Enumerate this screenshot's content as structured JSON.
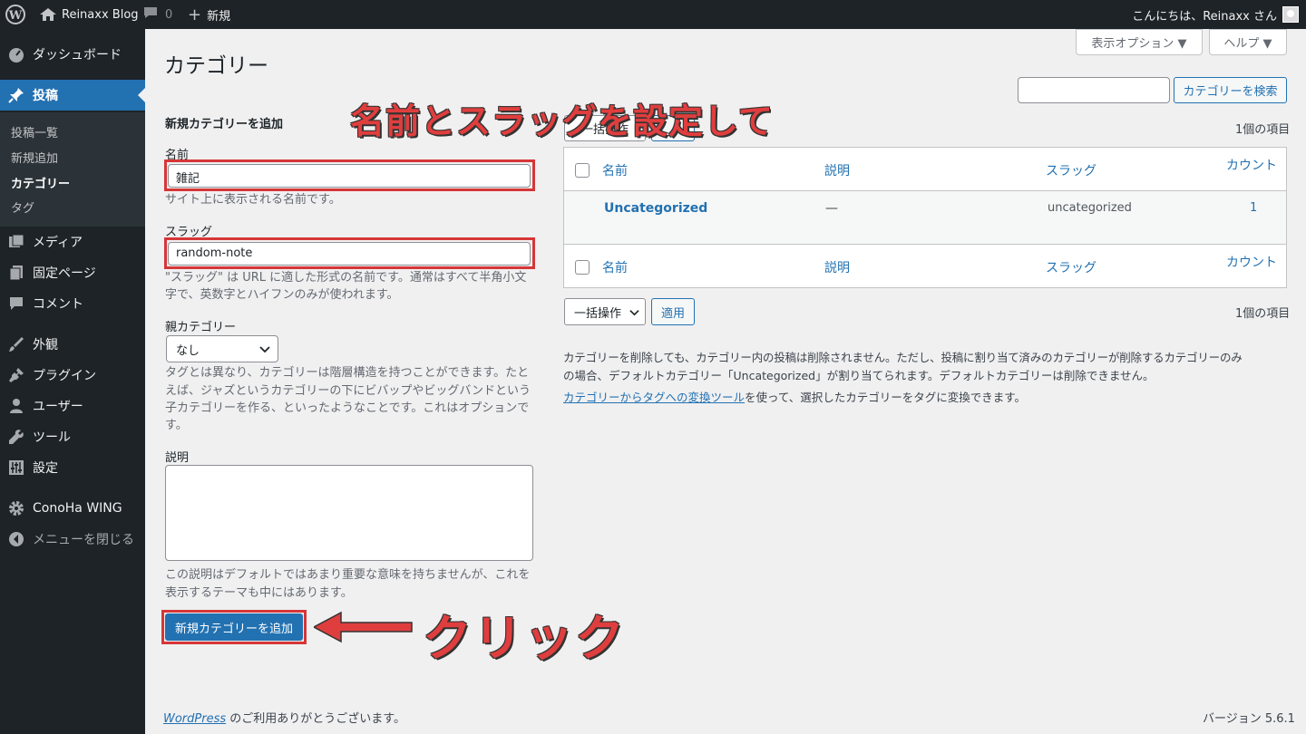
{
  "adminbar": {
    "site_name": "Reinaxx Blog",
    "comments_count": "0",
    "new_label": "新規",
    "greeting": "こんにちは、Reinaxx さん"
  },
  "sidebar": {
    "dashboard": "ダッシュボード",
    "posts": "投稿",
    "posts_sub": [
      "投稿一覧",
      "新規追加",
      "カテゴリー",
      "タグ"
    ],
    "media": "メディア",
    "pages": "固定ページ",
    "comments": "コメント",
    "appearance": "外観",
    "plugins": "プラグイン",
    "users": "ユーザー",
    "tools": "ツール",
    "settings": "設定",
    "conoha": "ConoHa WING",
    "collapse": "メニューを閉じる"
  },
  "header": {
    "screen_options": "表示オプション ▼",
    "help": "ヘルプ ▼",
    "page_title": "カテゴリー",
    "search_button": "カテゴリーを検索",
    "search_value": ""
  },
  "form": {
    "heading": "新規カテゴリーを追加",
    "name_label": "名前",
    "name_value": "雑記",
    "name_desc": "サイト上に表示される名前です。",
    "slug_label": "スラッグ",
    "slug_value": "random-note",
    "slug_desc_1": "\"スラッグ\" は URL に適した形式の名前です。通常はすべて半角小文",
    "slug_desc_2": "字で、英数字とハイフンのみが使われます。",
    "parent_label": "親カテゴリー",
    "parent_value": "なし",
    "parent_desc_1": "タグとは異なり、カテゴリーは階層構造を持つことができます。たと",
    "parent_desc_2": "えば、ジャズというカテゴリーの下にビバップやビッグバンドという",
    "parent_desc_3": "子カテゴリーを作る、といったようなことです。これはオプションで",
    "parent_desc_4": "す。",
    "description_label": "説明",
    "description_value": "",
    "description_desc_1": "この説明はデフォルトではあまり重要な意味を持ちませんが、これを",
    "description_desc_2": "表示するテーマも中にはあります。",
    "submit_label": "新規カテゴリーを追加"
  },
  "table": {
    "bulk_top": "一括操作",
    "items_count": "1個の項目",
    "columns": [
      "名前",
      "説明",
      "スラッグ",
      "カウント"
    ],
    "rows": [
      {
        "name": "Uncategorized",
        "description": "—",
        "slug": "uncategorized",
        "count": "1"
      }
    ],
    "bulk_bottom": "一括操作",
    "apply_bottom": "適用"
  },
  "notes": {
    "line1": "カテゴリーを削除しても、カテゴリー内の投稿は削除されません。ただし、投稿に割り当て済みのカテゴリーが削除するカテゴリーのみ",
    "line2": "の場合、デフォルトカテゴリー「Uncategorized」が割り当てられます。デフォルトカテゴリーは削除できません。",
    "link": "カテゴリーからタグへの変換ツール",
    "line3": "を使って、選択したカテゴリーをタグに変換できます。"
  },
  "footer": {
    "wp_link": "WordPress",
    "thanks": " のご利用ありがとうございます。",
    "version": "バージョン 5.6.1"
  },
  "annotations": {
    "top": "名前とスラッグを設定して",
    "click": "クリック"
  },
  "colors": {
    "annotation": "#e03e3e",
    "accent": "#2271b1"
  }
}
